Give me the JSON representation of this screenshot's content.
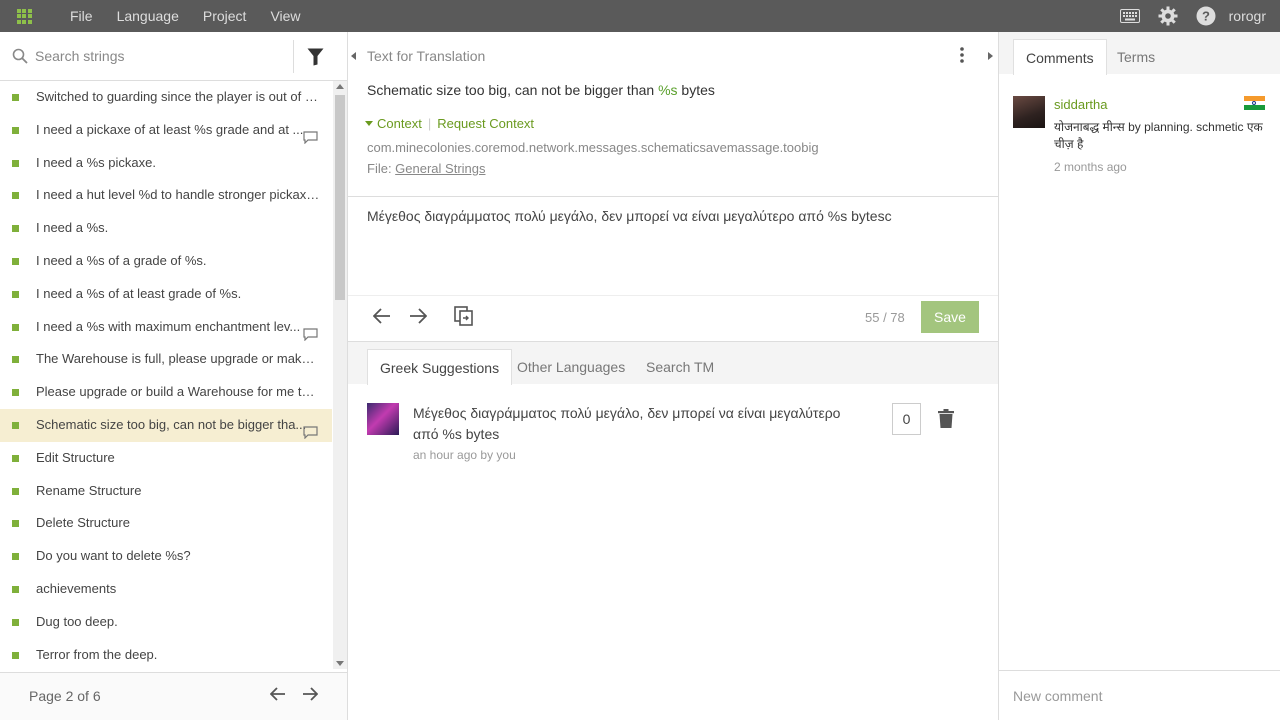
{
  "menu": {
    "items": [
      "File",
      "Language",
      "Project",
      "View"
    ]
  },
  "topbar": {
    "username": "rorogr"
  },
  "search": {
    "placeholder": "Search strings"
  },
  "strings": [
    {
      "text": "Switched to guarding since the player is out of si...",
      "comment": false,
      "active": false
    },
    {
      "text": "I need a pickaxe of at least %s grade and at ...",
      "comment": true,
      "active": false
    },
    {
      "text": "I need a %s pickaxe.",
      "comment": false,
      "active": false
    },
    {
      "text": "I need a hut level %d to handle stronger pickaxes.",
      "comment": false,
      "active": false
    },
    {
      "text": "I need a %s.",
      "comment": false,
      "active": false
    },
    {
      "text": "I need a %s of a grade of %s.",
      "comment": false,
      "active": false
    },
    {
      "text": "I need a %s of at least grade of %s.",
      "comment": false,
      "active": false
    },
    {
      "text": "I need a %s with maximum enchantment lev...",
      "comment": true,
      "active": false
    },
    {
      "text": "The Warehouse is full, please upgrade or make s...",
      "comment": false,
      "active": false
    },
    {
      "text": "Please upgrade or build a Warehouse for me to ...",
      "comment": false,
      "active": false
    },
    {
      "text": "Schematic size too big, can not be bigger tha...",
      "comment": true,
      "active": true
    },
    {
      "text": "Edit Structure",
      "comment": false,
      "active": false
    },
    {
      "text": "Rename Structure",
      "comment": false,
      "active": false
    },
    {
      "text": "Delete Structure",
      "comment": false,
      "active": false
    },
    {
      "text": "Do you want to delete %s?",
      "comment": false,
      "active": false
    },
    {
      "text": "achievements",
      "comment": false,
      "active": false
    },
    {
      "text": "Dug too deep.",
      "comment": false,
      "active": false
    },
    {
      "text": "Terror from the deep.",
      "comment": false,
      "active": false
    }
  ],
  "pager": {
    "label": "Page 2 of 6"
  },
  "editor": {
    "source_label": "Text for Translation",
    "source_before": "Schematic size too big, can not be bigger than ",
    "source_var": "%s",
    "source_after": " bytes",
    "context_toggle": "Context",
    "context_sep": "|",
    "request_context": "Request Context",
    "key": "com.minecolonies.coremod.network.messages.schematicsavemassage.toobig",
    "file_prefix": "File: ",
    "file_name": "General Strings",
    "translation": "Μέγεθος διαγράμματος πολύ μεγάλο, δεν μπορεί να είναι μεγαλύτερο από %s bytesc",
    "counter": "55 / 78",
    "save_label": "Save"
  },
  "tabs": [
    "Greek Suggestions",
    "Other Languages",
    "Search TM"
  ],
  "suggestion": {
    "text": "Μέγεθος διαγράμματος πολύ μεγάλο, δεν μπορεί να είναι μεγαλύτερο από %s bytes",
    "meta": "an hour ago by you",
    "votes": "0"
  },
  "right_tabs": [
    "Comments",
    "Terms"
  ],
  "comment": {
    "author": "siddartha",
    "text": "योजनाबद्ध मीन्स by planning. schmetic एक चीज़ है",
    "time": "2 months ago",
    "flag_colors": [
      "#f59a2c",
      "#ffffff",
      "#189a3a"
    ]
  },
  "new_comment": {
    "placeholder": "New comment"
  },
  "colors": {
    "accent": "#7fb03a",
    "topbar": "#5a5a5a",
    "save": "#a3c57e",
    "active_row": "#f6eed2"
  }
}
